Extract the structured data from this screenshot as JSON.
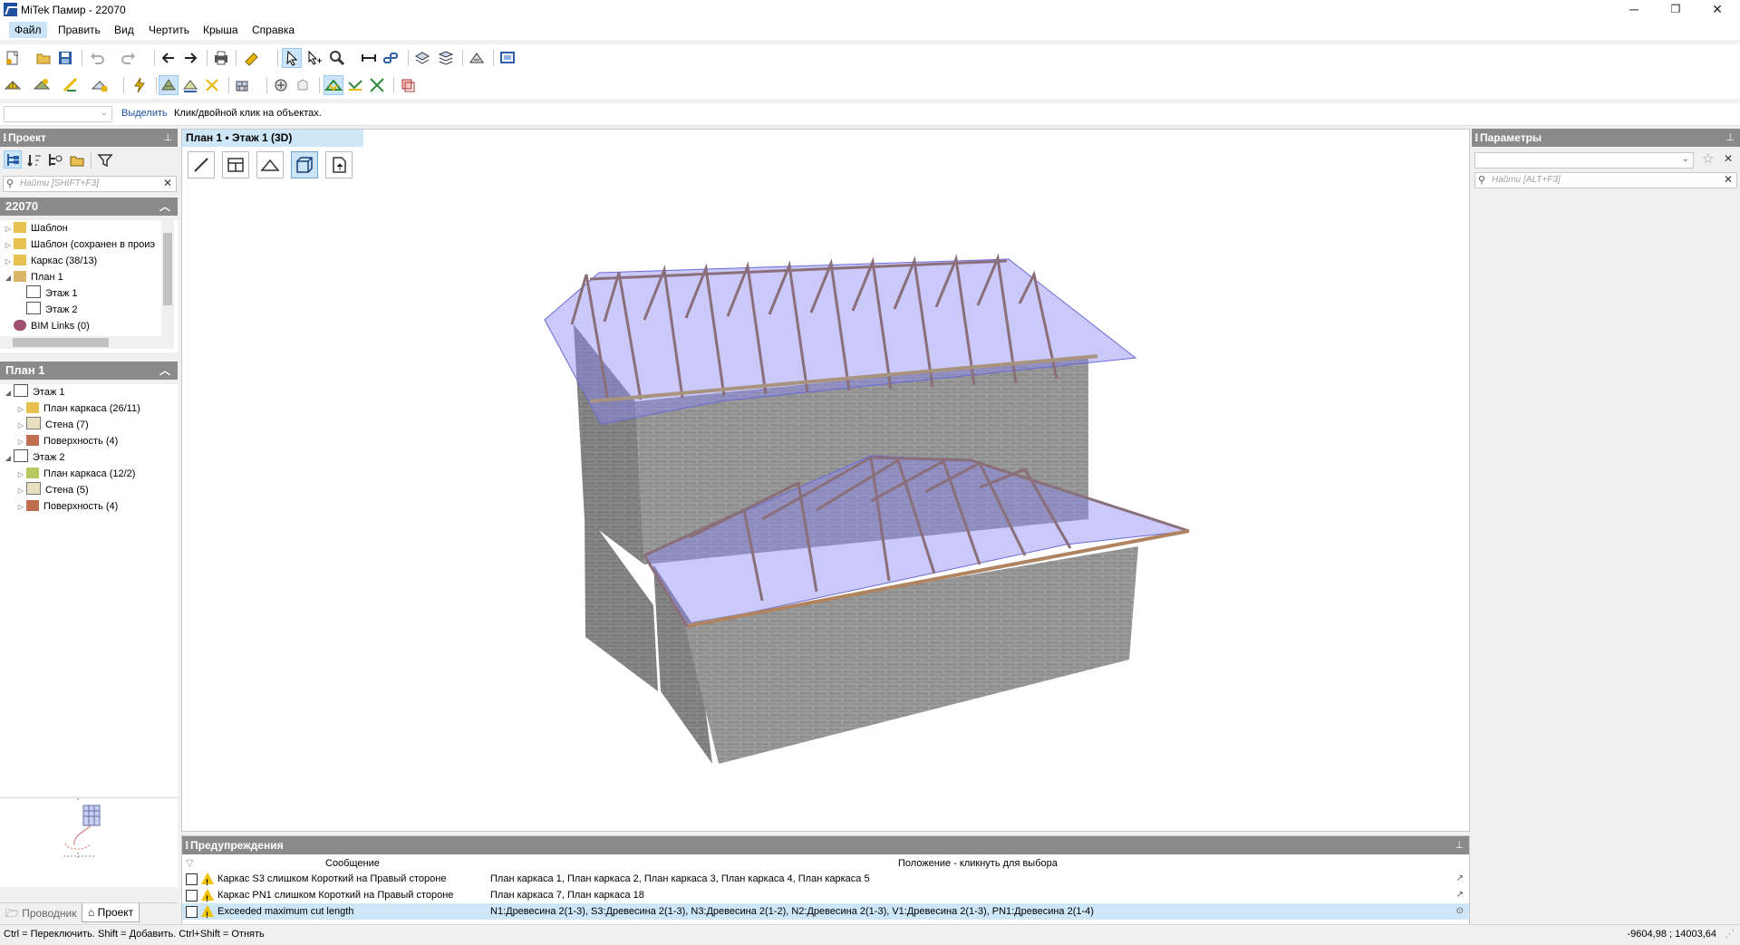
{
  "window": {
    "title": "MiTek Памир - 22070",
    "min": "─",
    "max": "❐",
    "close": "✕"
  },
  "menu": [
    "Файл",
    "Править",
    "Вид",
    "Чертить",
    "Крыша",
    "Справка"
  ],
  "selection_bar": {
    "mode": "Выделить",
    "hint": "Клик/двойной клик на объектах."
  },
  "project_panel": {
    "title": "Проект",
    "search_placeholder": "Найти [SHIFT+F3]",
    "project_name": "22070",
    "items": [
      "Шаблон",
      "Шаблон (сохранен в проиэ",
      "Каркас (38/13)",
      "План 1",
      "Этаж 1",
      "Этаж 2",
      "BIM Links (0)"
    ]
  },
  "plan_panel": {
    "title": "План 1",
    "items": [
      "Этаж 1",
      "План каркаса (26/11)",
      "Стена (7)",
      "Поверхность (4)",
      "Этаж 2",
      "План каркаса (12/2)",
      "Стена (5)",
      "Поверхность (4)"
    ]
  },
  "bottom_tabs": [
    "Проводник",
    "Проект"
  ],
  "viewport": {
    "tab": "План 1 • Этаж 1 (3D)"
  },
  "params_panel": {
    "title": "Параметры",
    "search_placeholder": "Найти [ALT+F3]"
  },
  "warnings": {
    "title": "Предупреждения",
    "col_message": "Сообщение",
    "col_position": "Положение - кликнуть для выбора",
    "rows": [
      {
        "message": "Каркас S3 слишком Короткий на Правый стороне",
        "position": "План каркаса 1, План каркаса 2, План каркаса 3, План каркаса 4, План каркаса 5"
      },
      {
        "message": "Каркас PN1 слишком Короткий на Правый стороне",
        "position": "План каркаса 7, План каркаса 18"
      },
      {
        "message": "Exceeded maximum cut length",
        "position": "N1:Древесина 2(1-3), S3:Древесина 2(1-3), N3:Древесина 2(1-2), N2:Древесина 2(1-3), V1:Древесина 2(1-3), PN1:Древесина 2(1-4)"
      }
    ]
  },
  "status": {
    "hint": "Ctrl = Переключить. Shift = Добавить. Ctrl+Shift = Отнять",
    "coords": "-9604,98 ; 14003,64"
  },
  "colors": {
    "selection": "#cce4f7",
    "panel_header": "#8a8a8a",
    "roof_plane": "#8080f0",
    "truss": "#8a6f7a",
    "brick": "#8d8d8d"
  }
}
